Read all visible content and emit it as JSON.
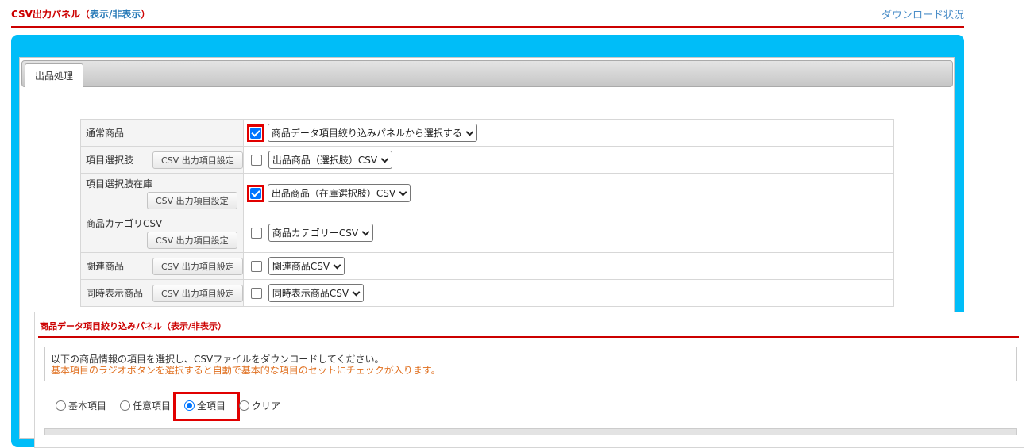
{
  "header": {
    "title": "CSV出力パネル",
    "toggle_open": "（",
    "toggle_text": "表示/非表示",
    "toggle_close": "）",
    "download_status_link": "ダウンロード状況"
  },
  "tabs": [
    {
      "label": "出品処理",
      "active": true
    }
  ],
  "rows": [
    {
      "label": "通常商品",
      "has_button": false,
      "checked": true,
      "highlighted": true,
      "select": "商品データ項目絞り込みパネルから選択する"
    },
    {
      "label": "項目選択肢",
      "has_button": true,
      "button": "CSV 出力項目設定",
      "checked": false,
      "highlighted": false,
      "select": "出品商品（選択肢）CSV"
    },
    {
      "label": "項目選択肢在庫",
      "has_button": true,
      "button": "CSV 出力項目設定",
      "checked": true,
      "highlighted": true,
      "select": "出品商品（在庫選択肢）CSV"
    },
    {
      "label": "商品カテゴリCSV",
      "has_button": true,
      "button": "CSV 出力項目設定",
      "checked": false,
      "highlighted": false,
      "select": "商品カテゴリーCSV"
    },
    {
      "label": "関連商品",
      "has_button": true,
      "button": "CSV 出力項目設定",
      "checked": false,
      "highlighted": false,
      "select": "関連商品CSV"
    },
    {
      "label": "同時表示商品",
      "has_button": true,
      "button": "CSV 出力項目設定",
      "checked": false,
      "highlighted": false,
      "select": "同時表示商品CSV"
    }
  ],
  "filter_panel": {
    "title": "商品データ項目絞り込みパネル",
    "toggle": "（表示/非表示）",
    "description_line1": "以下の商品情報の項目を選択し、CSVファイルをダウンロードしてください。",
    "description_line2": "基本項目のラジオボタンを選択すると自動で基本的な項目のセットにチェックが入ります。",
    "radios": [
      {
        "label": "基本項目",
        "selected": false
      },
      {
        "label": "任意項目",
        "selected": false
      },
      {
        "label": "全項目",
        "selected": true
      },
      {
        "label": "クリア",
        "selected": false
      }
    ]
  },
  "colors": {
    "accent_red": "#cc0000",
    "panel_blue": "#00bdf8",
    "highlight_red": "#e10000",
    "note_orange": "#e07020"
  }
}
